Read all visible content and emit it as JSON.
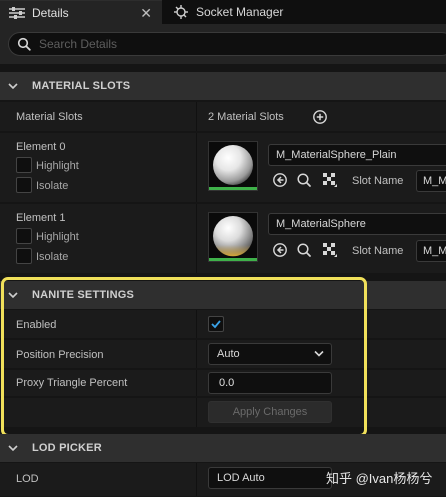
{
  "tabs": [
    {
      "label": "Details",
      "active": true
    },
    {
      "label": "Socket Manager",
      "active": false
    }
  ],
  "search": {
    "placeholder": "Search Details"
  },
  "material_slots": {
    "section_title": "MATERIAL SLOTS",
    "row_label": "Material Slots",
    "count_label": "2 Material Slots",
    "elements": [
      {
        "label": "Element 0",
        "highlight_label": "Highlight",
        "isolate_label": "Isolate",
        "material": "M_MaterialSphere_Plain",
        "slot_name_label": "Slot Name",
        "slot_name_value": "M_MaterialSphere_Plain"
      },
      {
        "label": "Element 1",
        "highlight_label": "Highlight",
        "isolate_label": "Isolate",
        "material": "M_MaterialSphere",
        "slot_name_label": "Slot Name",
        "slot_name_value": "M_MaterialSphere"
      }
    ]
  },
  "nanite": {
    "section_title": "NANITE SETTINGS",
    "enabled_label": "Enabled",
    "enabled_value": true,
    "position_precision_label": "Position Precision",
    "position_precision_value": "Auto",
    "proxy_triangle_label": "Proxy Triangle Percent",
    "proxy_triangle_value": "0.0",
    "apply_button": "Apply Changes"
  },
  "lod_picker": {
    "section_title": "LOD PICKER",
    "lod_label": "LOD",
    "lod_value": "LOD Auto"
  },
  "watermark": "知乎 @Ivan杨杨兮",
  "colors": {
    "accent_check": "#3aa3e8",
    "highlight_border": "#f0e05a",
    "material_bar": "#3fb24a"
  }
}
